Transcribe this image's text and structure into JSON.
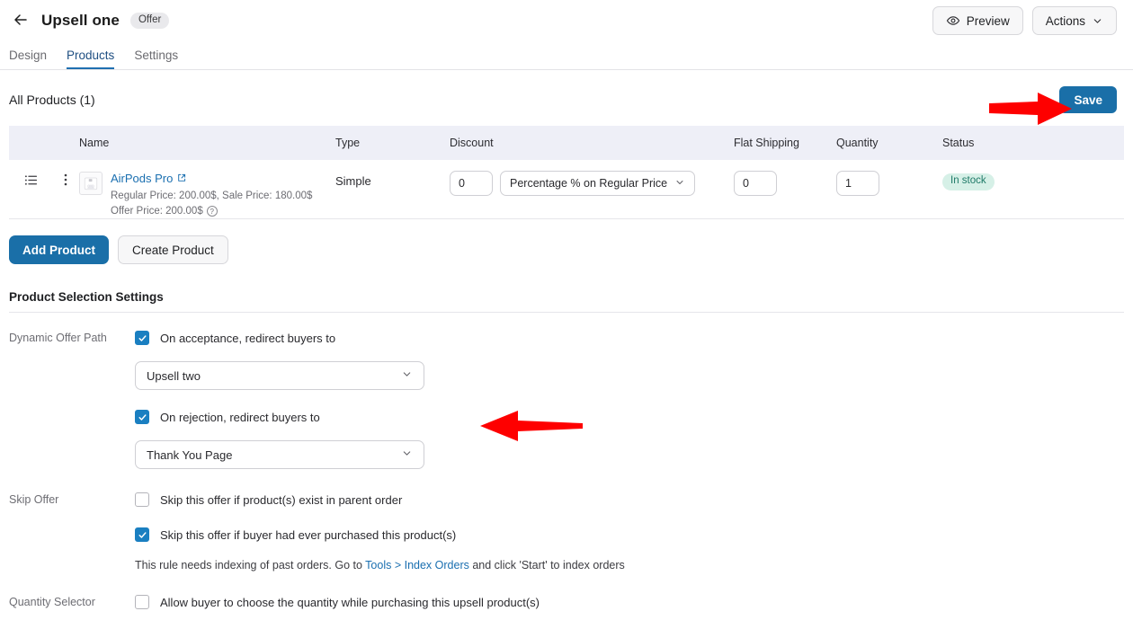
{
  "header": {
    "back_icon": "arrow-left-icon",
    "title": "Upsell one",
    "badge": "Offer",
    "preview_label": "Preview",
    "preview_icon": "eye-icon",
    "actions_label": "Actions",
    "actions_icon": "chevron-down-icon"
  },
  "tabs": [
    {
      "label": "Design",
      "active": false
    },
    {
      "label": "Products",
      "active": true
    },
    {
      "label": "Settings",
      "active": false
    }
  ],
  "products_section": {
    "title": "All Products (1)",
    "save_label": "Save"
  },
  "table": {
    "columns": [
      "Name",
      "Type",
      "Discount",
      "Flat Shipping",
      "Quantity",
      "Status"
    ],
    "rows": [
      {
        "drag_icon": "list-drag-icon",
        "menu_icon": "kebab-menu-icon",
        "thumbnail": "airpods-thumbnail",
        "name": "AirPods Pro",
        "external_icon": "external-link-icon",
        "meta_line1": "Regular Price: 200.00$, Sale Price: 180.00$",
        "meta_line2": "Offer Price: 200.00$",
        "help_icon": "question-mark-icon",
        "type": "Simple",
        "discount_value": "0",
        "discount_type": "Percentage % on Regular Price",
        "flat_shipping": "0",
        "quantity": "1",
        "status": "In stock"
      }
    ]
  },
  "actions": {
    "add_product": "Add Product",
    "create_product": "Create Product"
  },
  "settings": {
    "section_title": "Product Selection Settings",
    "dynamic_offer_path": {
      "label": "Dynamic Offer Path",
      "acceptance_checkbox": {
        "label": "On acceptance, redirect buyers to",
        "checked": true
      },
      "acceptance_select": "Upsell two",
      "rejection_checkbox": {
        "label": "On rejection, redirect buyers to",
        "checked": true
      },
      "rejection_select": "Thank You Page"
    },
    "skip_offer": {
      "label": "Skip Offer",
      "option1": {
        "label": "Skip this offer if product(s) exist in parent order",
        "checked": false
      },
      "option2": {
        "label": "Skip this offer if buyer had ever purchased this product(s)",
        "checked": true
      },
      "note_prefix": "This rule needs indexing of past orders. Go to ",
      "note_link": "Tools > Index Orders",
      "note_suffix": " and click 'Start' to index orders"
    },
    "quantity_selector": {
      "label": "Quantity Selector",
      "option": {
        "label": "Allow buyer to choose the quantity while purchasing this upsell product(s)",
        "checked": false
      }
    }
  },
  "annotations": {
    "arrow_save": "red-arrow-pointing-right",
    "arrow_offer_path": "red-arrow-pointing-left",
    "color": "#fe0000"
  }
}
